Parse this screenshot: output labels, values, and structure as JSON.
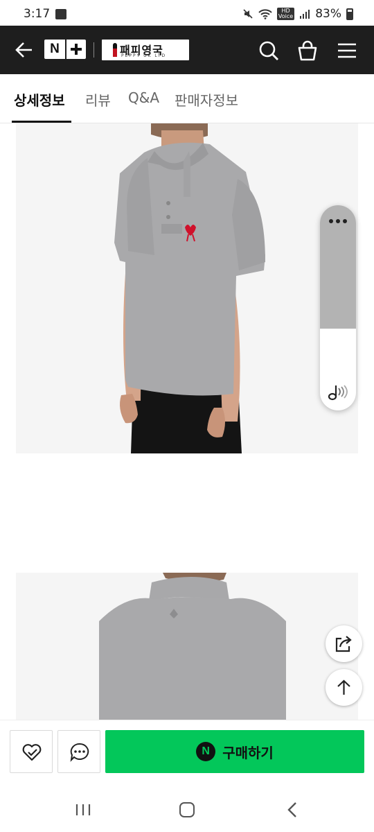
{
  "status_bar": {
    "time": "3:17",
    "hd_label": "HD\nVoice",
    "battery": "83%"
  },
  "header": {
    "nplus_label": "N",
    "store_name": "패피영국",
    "store_sub": "PEPPY UK LTD"
  },
  "tabs": [
    {
      "label": "상세정보",
      "active": true
    },
    {
      "label": "리뷰",
      "active": false
    },
    {
      "label": "Q&A",
      "active": false
    },
    {
      "label": "판매자정보",
      "active": false
    }
  ],
  "bottom_bar": {
    "buy_n_label": "N",
    "buy_label": "구매하기"
  },
  "colors": {
    "header_bg": "#1e1e1e",
    "buy_green": "#03c75a",
    "shirt_gray": "#a9a9ab",
    "logo_red": "#d0112b"
  }
}
